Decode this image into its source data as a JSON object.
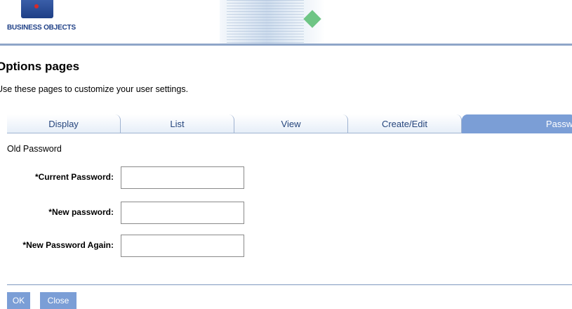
{
  "header": {
    "logo_text": "BUSINESS OBJECTS"
  },
  "page": {
    "title": "Options pages",
    "subtitle": "Use these pages to customize your user settings."
  },
  "tabs": [
    {
      "label": "Display"
    },
    {
      "label": "List"
    },
    {
      "label": "View"
    },
    {
      "label": "Create/Edit"
    },
    {
      "label": "Password",
      "active": true
    }
  ],
  "form": {
    "section_label": "Old Password",
    "fields": [
      {
        "label": "*Current Password:",
        "value": ""
      },
      {
        "label": "*New password:",
        "value": ""
      },
      {
        "label": "*New Password Again:",
        "value": ""
      }
    ]
  },
  "buttons": {
    "ok_label": "OK",
    "close_label": "Close"
  },
  "colors": {
    "tab_active": "#7b9ed6",
    "tab_text": "#25457c",
    "brand": "#1e3f86"
  }
}
